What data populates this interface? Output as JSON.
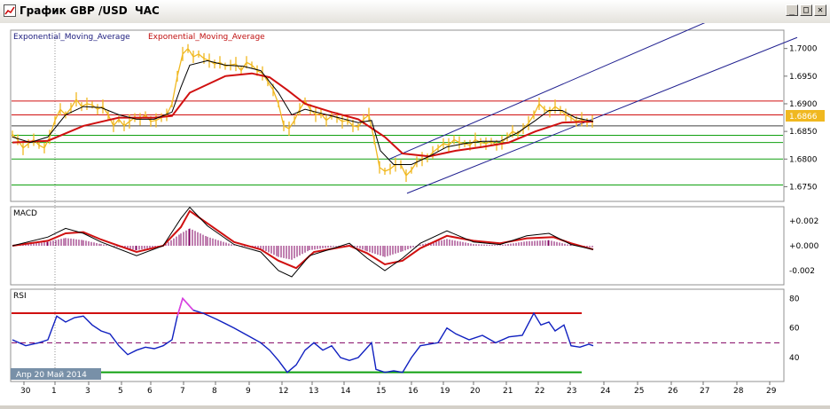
{
  "window": {
    "title": "График GBP /USD  ЧАС",
    "min_glyph": "_",
    "max_glyph": "□",
    "close_glyph": "✕"
  },
  "legend": {
    "ema1": "Exponential_Moving_Average",
    "ema2": "Exponential_Moving_Average"
  },
  "current_price": "1.6866",
  "panels": {
    "macd_label": "MACD",
    "rsi_label": "RSI"
  },
  "period_label": "Апр 20  Май 2014",
  "colors": {
    "price": "#f0b820",
    "ema_fast": "#000000",
    "ema_slow": "#d01010",
    "channel": "#202090",
    "support": "#10a010",
    "resistance": "#d01010",
    "macd_hist": "#800060",
    "rsi": "#1020c0"
  },
  "chart_data": [
    {
      "type": "line",
      "title": "",
      "series": [
        {
          "name": "Exponential_Moving_Average",
          "role": "ema_fast"
        },
        {
          "name": "Exponential_Moving_Average",
          "role": "ema_slow"
        }
      ],
      "x_ticks": [
        "30",
        "1",
        "3",
        "5",
        "6",
        "7",
        "8",
        "9",
        "12",
        "13",
        "14",
        "15",
        "16",
        "19",
        "20",
        "21",
        "22",
        "23",
        "24",
        "25",
        "26",
        "27",
        "28",
        "29"
      ],
      "y_ticks": [
        "1.7000",
        "1.6950",
        "1.6900",
        "1.6850",
        "1.6800",
        "1.6750"
      ],
      "ylim": [
        1.6725,
        1.703
      ],
      "price_path": [
        [
          0,
          1.6845
        ],
        [
          6,
          1.6835
        ],
        [
          12,
          1.682
        ],
        [
          18,
          1.6828
        ],
        [
          24,
          1.6835
        ],
        [
          30,
          1.6825
        ],
        [
          36,
          1.682
        ],
        [
          42,
          1.684
        ],
        [
          48,
          1.687
        ],
        [
          54,
          1.689
        ],
        [
          60,
          1.688
        ],
        [
          66,
          1.6892
        ],
        [
          72,
          1.6908
        ],
        [
          78,
          1.6895
        ],
        [
          84,
          1.69
        ],
        [
          90,
          1.6898
        ],
        [
          96,
          1.689
        ],
        [
          102,
          1.6895
        ],
        [
          108,
          1.688
        ],
        [
          114,
          1.686
        ],
        [
          120,
          1.6872
        ],
        [
          126,
          1.686
        ],
        [
          132,
          1.6868
        ],
        [
          138,
          1.6875
        ],
        [
          144,
          1.6872
        ],
        [
          150,
          1.688
        ],
        [
          156,
          1.6868
        ],
        [
          162,
          1.687
        ],
        [
          168,
          1.6875
        ],
        [
          174,
          1.688
        ],
        [
          180,
          1.69
        ],
        [
          186,
          1.695
        ],
        [
          192,
          1.699
        ],
        [
          198,
          1.7
        ],
        [
          204,
          1.6985
        ],
        [
          210,
          1.699
        ],
        [
          216,
          1.6982
        ],
        [
          222,
          1.6978
        ],
        [
          228,
          1.6972
        ],
        [
          234,
          1.6975
        ],
        [
          240,
          1.6968
        ],
        [
          246,
          1.697
        ],
        [
          252,
          1.6972
        ],
        [
          258,
          1.696
        ],
        [
          264,
          1.6975
        ],
        [
          270,
          1.697
        ],
        [
          276,
          1.696
        ],
        [
          282,
          1.6955
        ],
        [
          288,
          1.694
        ],
        [
          294,
          1.6925
        ],
        [
          300,
          1.69
        ],
        [
          306,
          1.686
        ],
        [
          312,
          1.6855
        ],
        [
          318,
          1.687
        ],
        [
          324,
          1.689
        ],
        [
          330,
          1.6905
        ],
        [
          336,
          1.689
        ],
        [
          342,
          1.688
        ],
        [
          348,
          1.6882
        ],
        [
          354,
          1.687
        ],
        [
          360,
          1.6878
        ],
        [
          366,
          1.6875
        ],
        [
          372,
          1.6868
        ],
        [
          378,
          1.687
        ],
        [
          384,
          1.686
        ],
        [
          390,
          1.6858
        ],
        [
          396,
          1.6872
        ],
        [
          402,
          1.688
        ],
        [
          408,
          1.6835
        ],
        [
          414,
          1.6785
        ],
        [
          420,
          1.6778
        ],
        [
          426,
          1.6782
        ],
        [
          432,
          1.679
        ],
        [
          438,
          1.679
        ],
        [
          444,
          1.677
        ],
        [
          450,
          1.678
        ],
        [
          456,
          1.6795
        ],
        [
          462,
          1.68
        ],
        [
          468,
          1.6802
        ],
        [
          474,
          1.6812
        ],
        [
          480,
          1.682
        ],
        [
          486,
          1.6828
        ],
        [
          492,
          1.6825
        ],
        [
          498,
          1.6835
        ],
        [
          504,
          1.683
        ],
        [
          510,
          1.6828
        ],
        [
          516,
          1.6825
        ],
        [
          522,
          1.6835
        ],
        [
          528,
          1.683
        ],
        [
          534,
          1.6828
        ],
        [
          540,
          1.6832
        ],
        [
          546,
          1.6825
        ],
        [
          552,
          1.683
        ],
        [
          558,
          1.684
        ],
        [
          564,
          1.685
        ],
        [
          570,
          1.6845
        ],
        [
          576,
          1.6855
        ],
        [
          582,
          1.6865
        ],
        [
          588,
          1.688
        ],
        [
          594,
          1.69
        ],
        [
          600,
          1.689
        ],
        [
          606,
          1.6885
        ],
        [
          612,
          1.6895
        ],
        [
          618,
          1.6888
        ],
        [
          624,
          1.688
        ],
        [
          630,
          1.6875
        ],
        [
          636,
          1.6868
        ],
        [
          642,
          1.6872
        ],
        [
          648,
          1.6866
        ],
        [
          654,
          1.6868
        ]
      ],
      "ema_fast_path": [
        [
          0,
          1.684
        ],
        [
          20,
          1.683
        ],
        [
          40,
          1.684
        ],
        [
          60,
          1.688
        ],
        [
          80,
          1.6895
        ],
        [
          100,
          1.6893
        ],
        [
          120,
          1.688
        ],
        [
          140,
          1.6872
        ],
        [
          160,
          1.6872
        ],
        [
          180,
          1.6885
        ],
        [
          190,
          1.693
        ],
        [
          200,
          1.697
        ],
        [
          220,
          1.6978
        ],
        [
          240,
          1.697
        ],
        [
          260,
          1.6968
        ],
        [
          280,
          1.696
        ],
        [
          300,
          1.692
        ],
        [
          315,
          1.688
        ],
        [
          330,
          1.689
        ],
        [
          350,
          1.6882
        ],
        [
          370,
          1.6874
        ],
        [
          390,
          1.6866
        ],
        [
          405,
          1.687
        ],
        [
          415,
          1.6815
        ],
        [
          430,
          1.679
        ],
        [
          450,
          1.679
        ],
        [
          470,
          1.6805
        ],
        [
          490,
          1.6822
        ],
        [
          510,
          1.6828
        ],
        [
          530,
          1.6832
        ],
        [
          550,
          1.6832
        ],
        [
          570,
          1.6848
        ],
        [
          590,
          1.687
        ],
        [
          605,
          1.6888
        ],
        [
          620,
          1.6888
        ],
        [
          635,
          1.6875
        ],
        [
          655,
          1.6868
        ]
      ],
      "ema_slow_path": [
        [
          0,
          1.683
        ],
        [
          40,
          1.6833
        ],
        [
          80,
          1.686
        ],
        [
          120,
          1.6875
        ],
        [
          160,
          1.6875
        ],
        [
          180,
          1.6878
        ],
        [
          200,
          1.692
        ],
        [
          240,
          1.695
        ],
        [
          270,
          1.6955
        ],
        [
          290,
          1.6948
        ],
        [
          310,
          1.6925
        ],
        [
          330,
          1.69
        ],
        [
          360,
          1.6885
        ],
        [
          390,
          1.6872
        ],
        [
          420,
          1.684
        ],
        [
          440,
          1.681
        ],
        [
          470,
          1.6805
        ],
        [
          500,
          1.6815
        ],
        [
          530,
          1.6822
        ],
        [
          560,
          1.683
        ],
        [
          590,
          1.685
        ],
        [
          620,
          1.6866
        ],
        [
          655,
          1.6868
        ]
      ],
      "resistance_levels": [
        1.6905,
        1.688
      ],
      "support_levels": [
        1.686,
        1.6843,
        1.683,
        1.68,
        1.6753
      ],
      "channel": {
        "upper": [
          [
            425,
            1.68
          ],
          [
            800,
            1.706
          ]
        ],
        "lower": [
          [
            445,
            1.6738
          ],
          [
            885,
            1.702
          ]
        ]
      }
    },
    {
      "type": "line",
      "title": "MACD",
      "y_ticks": [
        "+0.002",
        "+0.000",
        "-0.002"
      ],
      "ylim": [
        -0.003,
        0.003
      ],
      "signal_path": [
        [
          0,
          0.0
        ],
        [
          40,
          0.0004
        ],
        [
          60,
          0.001
        ],
        [
          80,
          0.0011
        ],
        [
          100,
          0.0005
        ],
        [
          140,
          -0.0005
        ],
        [
          170,
          0.0
        ],
        [
          190,
          0.0015
        ],
        [
          200,
          0.0028
        ],
        [
          220,
          0.0018
        ],
        [
          250,
          0.0003
        ],
        [
          280,
          -0.0003
        ],
        [
          300,
          -0.0012
        ],
        [
          320,
          -0.0018
        ],
        [
          340,
          -0.0005
        ],
        [
          380,
          0.0
        ],
        [
          400,
          -0.0006
        ],
        [
          420,
          -0.0015
        ],
        [
          440,
          -0.0012
        ],
        [
          460,
          -0.0002
        ],
        [
          490,
          0.0008
        ],
        [
          520,
          0.0004
        ],
        [
          550,
          0.0002
        ],
        [
          580,
          0.0006
        ],
        [
          610,
          0.0007
        ],
        [
          630,
          0.0002
        ],
        [
          655,
          -0.0003
        ]
      ],
      "macd_path": [
        [
          0,
          0.0
        ],
        [
          40,
          0.0007
        ],
        [
          60,
          0.0014
        ],
        [
          80,
          0.001
        ],
        [
          100,
          0.0003
        ],
        [
          140,
          -0.0008
        ],
        [
          170,
          0.0
        ],
        [
          190,
          0.0022
        ],
        [
          200,
          0.0031
        ],
        [
          220,
          0.0016
        ],
        [
          250,
          0.0001
        ],
        [
          280,
          -0.0005
        ],
        [
          300,
          -0.002
        ],
        [
          315,
          -0.0025
        ],
        [
          335,
          -0.0008
        ],
        [
          380,
          0.0002
        ],
        [
          400,
          -0.001
        ],
        [
          420,
          -0.002
        ],
        [
          440,
          -0.001
        ],
        [
          460,
          0.0002
        ],
        [
          490,
          0.0012
        ],
        [
          520,
          0.0003
        ],
        [
          550,
          0.0001
        ],
        [
          580,
          0.0008
        ],
        [
          605,
          0.001
        ],
        [
          630,
          0.0001
        ],
        [
          655,
          -0.0003
        ]
      ]
    },
    {
      "type": "line",
      "title": "RSI",
      "y_ticks": [
        "80",
        "60",
        "40"
      ],
      "ylim": [
        25,
        85
      ],
      "overbought": 70,
      "oversold": 30,
      "mid": 50,
      "rsi_path": [
        [
          0,
          52
        ],
        [
          15,
          48
        ],
        [
          30,
          50
        ],
        [
          40,
          52
        ],
        [
          50,
          68
        ],
        [
          60,
          64
        ],
        [
          70,
          67
        ],
        [
          80,
          68
        ],
        [
          90,
          62
        ],
        [
          100,
          58
        ],
        [
          110,
          56
        ],
        [
          120,
          48
        ],
        [
          130,
          42
        ],
        [
          140,
          45
        ],
        [
          150,
          47
        ],
        [
          160,
          46
        ],
        [
          170,
          48
        ],
        [
          180,
          52
        ],
        [
          186,
          68
        ],
        [
          192,
          80
        ],
        [
          198,
          76
        ],
        [
          204,
          72
        ],
        [
          215,
          70
        ],
        [
          230,
          66
        ],
        [
          250,
          60
        ],
        [
          265,
          55
        ],
        [
          280,
          50
        ],
        [
          290,
          45
        ],
        [
          300,
          38
        ],
        [
          310,
          30
        ],
        [
          320,
          35
        ],
        [
          330,
          45
        ],
        [
          340,
          50
        ],
        [
          350,
          45
        ],
        [
          360,
          48
        ],
        [
          370,
          40
        ],
        [
          380,
          38
        ],
        [
          390,
          40
        ],
        [
          405,
          50
        ],
        [
          410,
          32
        ],
        [
          420,
          30
        ],
        [
          430,
          31
        ],
        [
          440,
          30
        ],
        [
          450,
          40
        ],
        [
          460,
          48
        ],
        [
          480,
          50
        ],
        [
          490,
          60
        ],
        [
          500,
          56
        ],
        [
          515,
          52
        ],
        [
          530,
          55
        ],
        [
          545,
          50
        ],
        [
          560,
          54
        ],
        [
          575,
          55
        ],
        [
          588,
          70
        ],
        [
          596,
          62
        ],
        [
          605,
          64
        ],
        [
          612,
          58
        ],
        [
          622,
          62
        ],
        [
          630,
          48
        ],
        [
          640,
          47
        ],
        [
          650,
          49
        ],
        [
          655,
          48
        ]
      ]
    }
  ]
}
